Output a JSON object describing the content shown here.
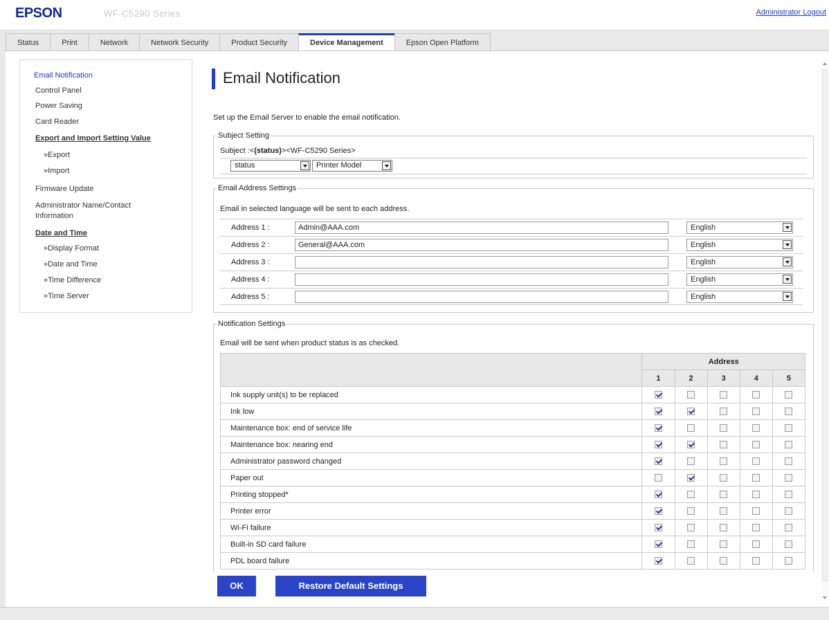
{
  "header": {
    "logo": "EPSON",
    "model": "WF-C5290 Series",
    "logout": "Administrator Logout"
  },
  "tabs": [
    {
      "label": "Status"
    },
    {
      "label": "Print"
    },
    {
      "label": "Network"
    },
    {
      "label": "Network Security"
    },
    {
      "label": "Product Security"
    },
    {
      "label": "Device Management",
      "active": true
    },
    {
      "label": "Epson Open Platform"
    }
  ],
  "sidebar": [
    {
      "label": "Email Notification",
      "active": true
    },
    {
      "label": "Control Panel"
    },
    {
      "label": "Power Saving"
    },
    {
      "label": "Card Reader"
    },
    {
      "label": "Export and Import Setting Value",
      "heading": true
    },
    {
      "label": "»Export",
      "sub": true
    },
    {
      "label": "»Import",
      "sub": true
    },
    {
      "label": "Firmware Update"
    },
    {
      "label": "Administrator Name/Contact"
    },
    {
      "label": "Information"
    },
    {
      "label": "Date and Time",
      "heading": true
    },
    {
      "label": "»Display Format",
      "sub": true
    },
    {
      "label": "»Date and Time",
      "sub": true
    },
    {
      "label": "»Time Difference",
      "sub": true
    },
    {
      "label": "»Time Server",
      "sub": true
    }
  ],
  "page": {
    "title": "Email Notification",
    "description": "Set up the Email Server to enable the email notification."
  },
  "subject": {
    "legend": "Subject Setting",
    "prefix": "Subject :<",
    "status_token": "(status)",
    "suffix": "><WF-C5290 Series>",
    "select1": "status",
    "select2": "Printer Model"
  },
  "address_settings": {
    "legend": "Email Address Settings",
    "note": "Email in selected language will be sent to each address.",
    "rows": [
      {
        "label": "Address 1 :",
        "value": "Admin@AAA.com",
        "lang": "English"
      },
      {
        "label": "Address 2 :",
        "value": "General@AAA.com",
        "lang": "English"
      },
      {
        "label": "Address 3 :",
        "value": "",
        "lang": "English"
      },
      {
        "label": "Address 4 :",
        "value": "",
        "lang": "English"
      },
      {
        "label": "Address 5 :",
        "value": "",
        "lang": "English"
      }
    ]
  },
  "notification": {
    "legend": "Notification Settings",
    "note": "Email will be sent when product status is as checked.",
    "header": "Address",
    "columns": [
      "1",
      "2",
      "3",
      "4",
      "5"
    ],
    "rows": [
      {
        "label": "Ink supply unit(s) to be replaced",
        "checks": [
          true,
          false,
          false,
          false,
          false
        ]
      },
      {
        "label": "Ink low",
        "checks": [
          true,
          true,
          false,
          false,
          false
        ]
      },
      {
        "label": "Maintenance box: end of service life",
        "checks": [
          true,
          false,
          false,
          false,
          false
        ]
      },
      {
        "label": "Maintenance box: nearing end",
        "checks": [
          true,
          true,
          false,
          false,
          false
        ]
      },
      {
        "label": "Administrator password changed",
        "checks": [
          true,
          false,
          false,
          false,
          false
        ]
      },
      {
        "label": "Paper out",
        "checks": [
          false,
          true,
          false,
          false,
          false
        ]
      },
      {
        "label": "Printing stopped*",
        "checks": [
          true,
          false,
          false,
          false,
          false
        ]
      },
      {
        "label": "Printer error",
        "checks": [
          true,
          false,
          false,
          false,
          false
        ]
      },
      {
        "label": "Wi-Fi failure",
        "checks": [
          true,
          false,
          false,
          false,
          false
        ]
      },
      {
        "label": "Built-in SD card failure",
        "checks": [
          true,
          false,
          false,
          false,
          false
        ]
      },
      {
        "label": "PDL board failure",
        "checks": [
          true,
          false,
          false,
          false,
          false
        ]
      }
    ]
  },
  "buttons": {
    "ok": "OK",
    "restore": "Restore Default Settings"
  },
  "colors": {
    "accent": "#1f3fc4",
    "button": "#2944c6",
    "link": "#1a3cc7"
  }
}
